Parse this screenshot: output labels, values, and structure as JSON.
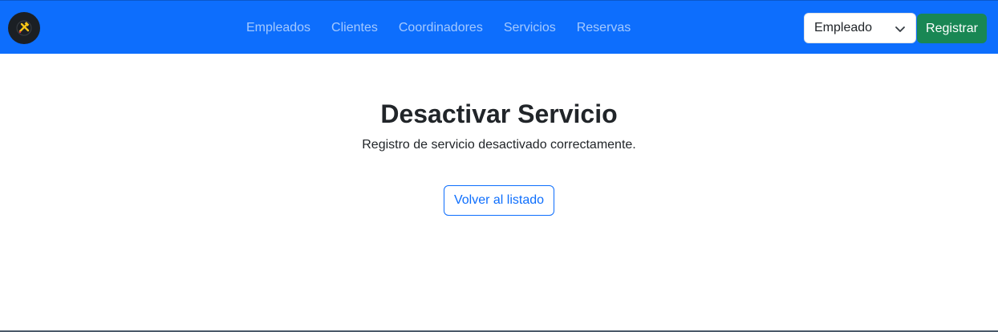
{
  "navbar": {
    "logo_icon": "tools-icon",
    "links": [
      "Empleados",
      "Clientes",
      "Coordinadores",
      "Servicios",
      "Reservas"
    ],
    "role_select": {
      "selected": "Empleado",
      "icon": "chevron-down-icon"
    },
    "register_label": "Registrar"
  },
  "main": {
    "title": "Desactivar Servicio",
    "message": "Registro de servicio desactivado correctamente.",
    "back_label": "Volver al listado"
  },
  "colors": {
    "navbar_bg": "#0d6efd",
    "register_bg": "#198754",
    "back_border": "#0d6efd"
  }
}
